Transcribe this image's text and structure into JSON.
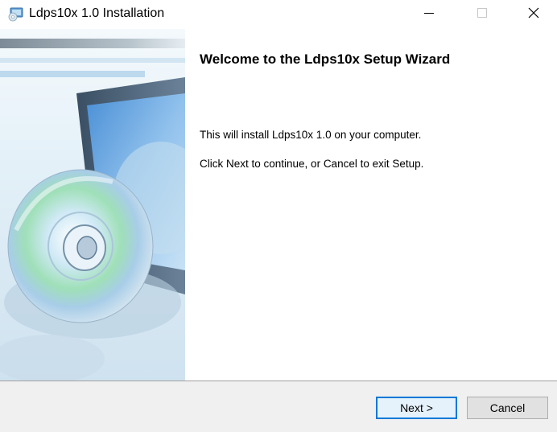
{
  "window": {
    "title": "Ldps10x 1.0 Installation",
    "icons": {
      "app": "installer-icon",
      "minimize": "minimize-icon",
      "maximize": "maximize-icon",
      "close": "close-icon"
    }
  },
  "sidebar": {
    "image": "cd-disc-monitor-artwork"
  },
  "main": {
    "heading": "Welcome to the Ldps10x Setup Wizard",
    "line1": "This will install Ldps10x 1.0 on your computer.",
    "line2": "Click Next to continue, or Cancel to exit Setup."
  },
  "footer": {
    "next_label": "Next >",
    "cancel_label": "Cancel"
  },
  "colors": {
    "accent": "#0078d7",
    "footer_bg": "#f0f0f0"
  }
}
